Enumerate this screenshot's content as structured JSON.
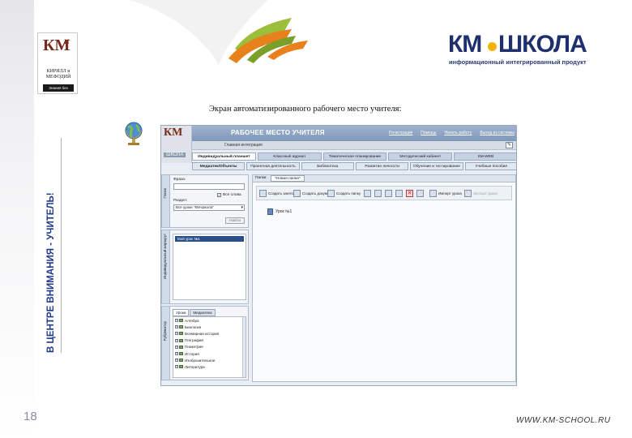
{
  "logo": {
    "letters": "КМ",
    "small": "и",
    "line1": "КИРИЛЛ и",
    "line2": "МЕФОДИЙ",
    "tagline": "Знания без границ"
  },
  "brand": {
    "km": "КМ",
    "school": "ШКОЛА",
    "subtitle": "информационный интегрированный продукт",
    "accent": "#1e2f6e",
    "dot": "#f2b400"
  },
  "vertical_title": "В ЦЕНТРЕ ВНИМАНИЯ - УЧИТЕЛЬ!",
  "caption": "Экран автоматизированного рабочего место учителя:",
  "page_number": "18",
  "footer_url": "WWW.KM-SCHOOL.RU",
  "app": {
    "title": "РАБОЧЕЕ МЕСТО УЧИТЕЛЯ",
    "sub_label": "Главная интеграция",
    "header_links": [
      "Регистрация",
      "Помощь",
      "Начать работу",
      "Выход из системы"
    ],
    "tabs_row1": [
      {
        "label": "Индивидуальный планшет",
        "active": true
      },
      {
        "label": "Классный журнал",
        "active": false
      },
      {
        "label": "Тематическое планирование",
        "active": false
      },
      {
        "label": "Методический кабинет",
        "active": false
      },
      {
        "label": "КМ-WEB",
        "active": false
      }
    ],
    "tabs_row2": [
      {
        "label": "Медиатек/Объекты",
        "active": true
      },
      {
        "label": "Проектная деятельность",
        "active": false
      },
      {
        "label": "Библиотека",
        "active": false
      },
      {
        "label": "Развитие личности",
        "active": false
      },
      {
        "label": "Обучение и тестирование",
        "active": false
      },
      {
        "label": "Учебные пособия",
        "active": false
      }
    ],
    "search": {
      "strip_label": "Поиск",
      "phrase_label": "Фраза:",
      "phrase_value": "",
      "all_words_label": "Все слова",
      "all_words_checked": true,
      "section_label": "Раздел:",
      "section_value": "Все уроки \"КМ-Школа\"",
      "find_button": "Найти"
    },
    "routes": {
      "strip_label": "Индивидуальный маршрут",
      "selected": "Мой урок №1"
    },
    "rubric": {
      "strip_label": "Рубрикатор",
      "tabs": [
        {
          "label": "Уроки",
          "active": true
        },
        {
          "label": "Медиатека",
          "active": false
        }
      ],
      "items": [
        "Алгебра",
        "Биология",
        "Всемирная история",
        "География",
        "Геометрия",
        "История",
        "Изобразительное",
        "Литература"
      ]
    },
    "main": {
      "tab_label": "Папки",
      "doc_tab": "*Новая папка*",
      "toolbar": [
        {
          "label": "Создать занятие",
          "enabled": true
        },
        {
          "label": "Создать документ",
          "enabled": true
        },
        {
          "label": "Создать папку",
          "enabled": true
        },
        {
          "label": "Импорт урока",
          "enabled": true
        },
        {
          "label": "Экспорт урока",
          "enabled": false
        }
      ],
      "delete_glyph": "✕",
      "items": [
        "Урок №1"
      ]
    }
  }
}
